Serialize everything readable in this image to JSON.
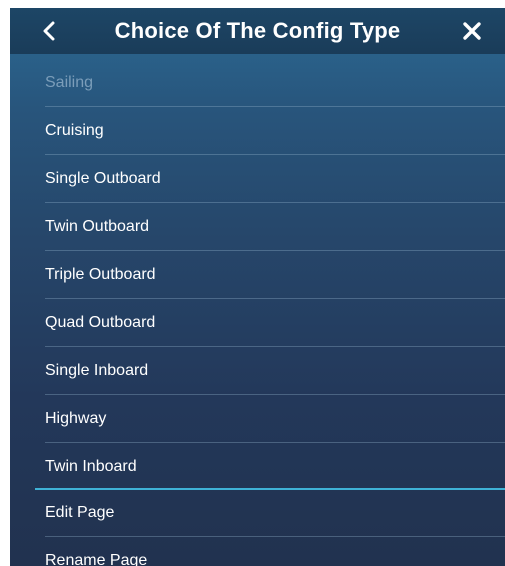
{
  "header": {
    "back_icon": "chevron-left-icon",
    "title": "Choice Of The Config Type",
    "close_icon": "close-icon"
  },
  "config_types": [
    {
      "label": "Sailing",
      "enabled": false
    },
    {
      "label": "Cruising",
      "enabled": true
    },
    {
      "label": "Single Outboard",
      "enabled": true
    },
    {
      "label": "Twin Outboard",
      "enabled": true
    },
    {
      "label": "Triple Outboard",
      "enabled": true
    },
    {
      "label": "Quad Outboard",
      "enabled": true
    },
    {
      "label": "Single Inboard",
      "enabled": true
    },
    {
      "label": "Highway",
      "enabled": true
    },
    {
      "label": "Twin Inboard",
      "enabled": true
    }
  ],
  "page_actions": [
    {
      "label": "Edit Page"
    },
    {
      "label": "Rename Page"
    }
  ],
  "colors": {
    "divider_accent": "#3fb2d6",
    "disabled_text": "#7b9db9",
    "text": "#ffffff"
  }
}
